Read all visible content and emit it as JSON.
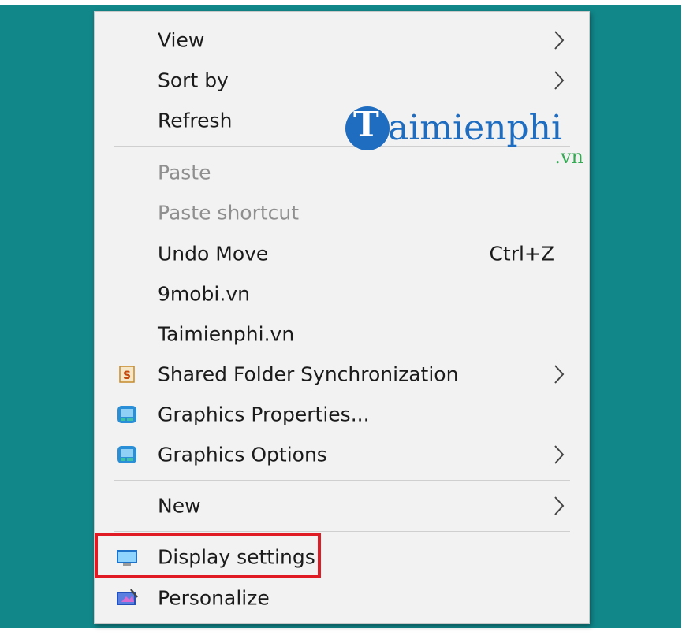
{
  "context_menu": {
    "items": [
      {
        "label": "View",
        "submenu": true,
        "disabled": false
      },
      {
        "label": "Sort by",
        "submenu": true,
        "disabled": false
      },
      {
        "label": "Refresh",
        "submenu": false,
        "disabled": false
      },
      {
        "label": "Paste",
        "submenu": false,
        "disabled": true
      },
      {
        "label": "Paste shortcut",
        "submenu": false,
        "disabled": true
      },
      {
        "label": "Undo Move",
        "shortcut": "Ctrl+Z",
        "submenu": false,
        "disabled": false
      },
      {
        "label": "9mobi.vn",
        "submenu": false,
        "disabled": false
      },
      {
        "label": "Taimienphi.vn",
        "submenu": false,
        "disabled": false
      },
      {
        "label": "Shared Folder Synchronization",
        "icon": "shared-folder-sync-icon",
        "submenu": true,
        "disabled": false
      },
      {
        "label": "Graphics Properties...",
        "icon": "graphics-properties-icon",
        "submenu": false,
        "disabled": false
      },
      {
        "label": "Graphics Options",
        "icon": "graphics-options-icon",
        "submenu": true,
        "disabled": false
      },
      {
        "label": "New",
        "submenu": true,
        "disabled": false
      },
      {
        "label": "Display settings",
        "icon": "display-settings-icon",
        "submenu": false,
        "disabled": false,
        "highlighted": true
      },
      {
        "label": "Personalize",
        "icon": "personalize-icon",
        "submenu": false,
        "disabled": false
      }
    ]
  },
  "watermark": {
    "logo_letter": "T",
    "text": "aimienphi",
    "suffix": ".vn"
  },
  "colors": {
    "desktop": "#11878a",
    "menu_background": "#f2f2f2",
    "highlight_border": "#e01b24",
    "watermark_blue": "#1f6dc0",
    "watermark_green": "#34a853"
  }
}
